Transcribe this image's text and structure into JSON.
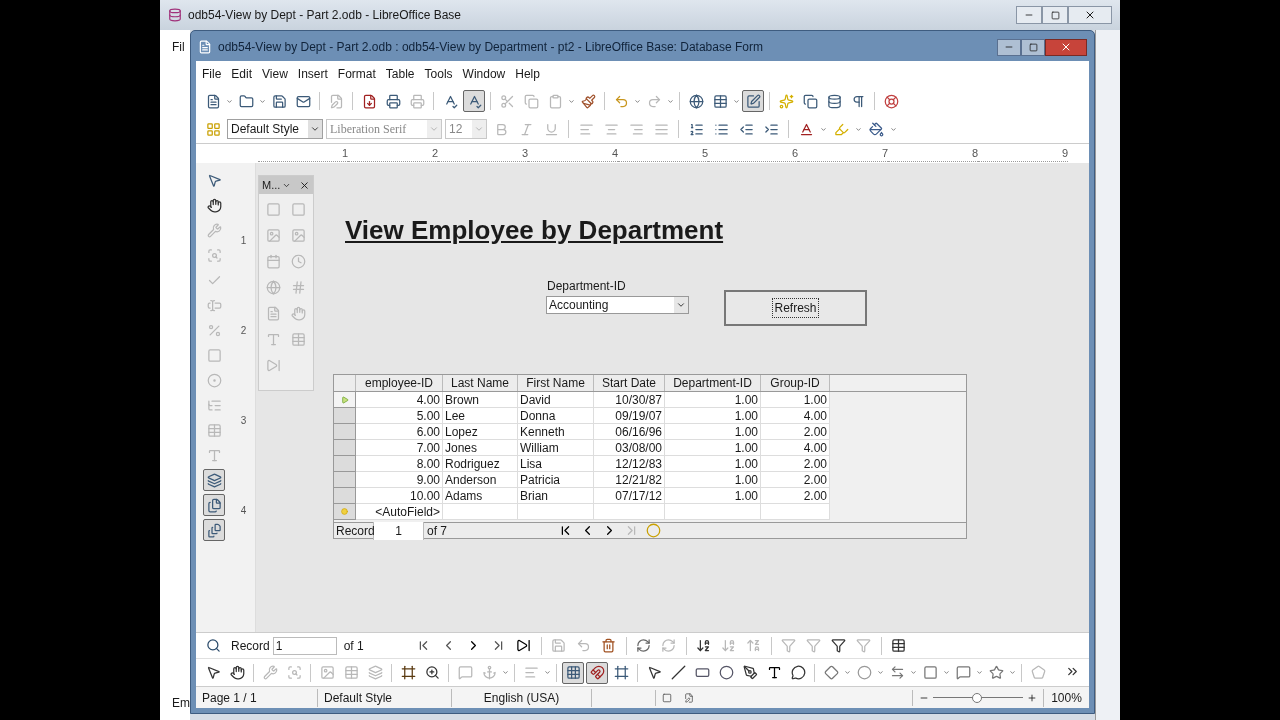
{
  "back_window": {
    "title": "odb54-View by Dept - Part 2.odb - LibreOffice Base",
    "menu_fragment": "Fil",
    "bottom_fragment": "Em"
  },
  "window": {
    "title": "odb54-View by Dept - Part 2.odb : odb54-View by Department - pt2 - LibreOffice Base: Database Form"
  },
  "menu": [
    "File",
    "Edit",
    "View",
    "Insert",
    "Format",
    "Table",
    "Tools",
    "Window",
    "Help"
  ],
  "toolbar": {
    "design_mode": true,
    "paragraph_style": "Default Style",
    "font_name": "Liberation Serif",
    "font_size": "12"
  },
  "ruler": {
    "marks": [
      "1",
      "2",
      "3",
      "4",
      "5",
      "6",
      "7",
      "8",
      "9"
    ],
    "vertical_marks": [
      "1",
      "2",
      "3",
      "4"
    ]
  },
  "form_controls": {
    "design_tools_on": true
  },
  "toolbox": {
    "title": "M..."
  },
  "form": {
    "heading": "View Employee by Department",
    "department_label": "Department-ID",
    "department_value": "Accounting",
    "refresh_button": "Refresh"
  },
  "grid": {
    "columns": [
      "employee-ID",
      "Last Name",
      "First Name",
      "Start Date",
      "Department-ID",
      "Group-ID"
    ],
    "rows": [
      {
        "selected": true,
        "cells": [
          "4.00",
          "Brown",
          "David",
          "10/30/87",
          "1.00",
          "1.00"
        ]
      },
      {
        "selected": false,
        "cells": [
          "5.00",
          "Lee",
          "Donna",
          "09/19/07",
          "1.00",
          "4.00"
        ]
      },
      {
        "selected": false,
        "cells": [
          "6.00",
          "Lopez",
          "Kenneth",
          "06/16/96",
          "1.00",
          "2.00"
        ]
      },
      {
        "selected": false,
        "cells": [
          "7.00",
          "Jones",
          "William",
          "03/08/00",
          "1.00",
          "4.00"
        ]
      },
      {
        "selected": false,
        "cells": [
          "8.00",
          "Rodriguez",
          "Lisa",
          "12/12/83",
          "1.00",
          "2.00"
        ]
      },
      {
        "selected": false,
        "cells": [
          "9.00",
          "Anderson",
          "Patricia",
          "12/21/82",
          "1.00",
          "2.00"
        ]
      },
      {
        "selected": false,
        "cells": [
          "10.00",
          "Adams",
          "Brian",
          "07/17/12",
          "1.00",
          "2.00"
        ]
      }
    ],
    "new_row": "<AutoField>",
    "record_label": "Record",
    "record_number": "1",
    "record_total": "of 7"
  },
  "navigation": {
    "label": "Record",
    "value": "1",
    "total": "of 1"
  },
  "drawing": {
    "snap_to_grid": true,
    "guides": true
  },
  "status_bar": {
    "page": "Page 1 / 1",
    "style": "Default Style",
    "language": "English (USA)",
    "zoom_slider": {
      "level": 0.49
    },
    "zoom": "100%"
  }
}
